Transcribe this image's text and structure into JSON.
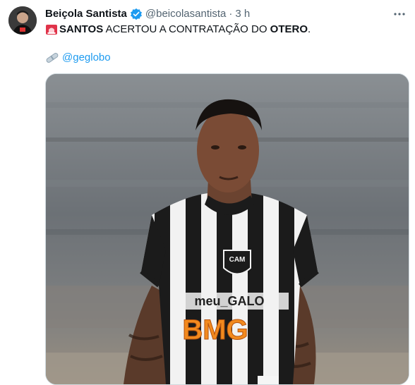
{
  "tweet": {
    "display_name": "Beiçola Santista",
    "handle": "@beicolasantista",
    "separator": "·",
    "time": "3 h",
    "more_label": "···",
    "text": {
      "part1": "SANTOS",
      "part2": " ACERTOU A CONTRATAÇÃO DO ",
      "part3": "OTERO",
      "part4": "."
    },
    "mention": "@geglobo",
    "image": {
      "jersey_sponsor": "meu_GALO",
      "jersey_brand": "BMG",
      "crest": "CAM"
    }
  },
  "colors": {
    "accent": "#1d9bf0",
    "text": "#0f1419",
    "muted": "#536471"
  }
}
